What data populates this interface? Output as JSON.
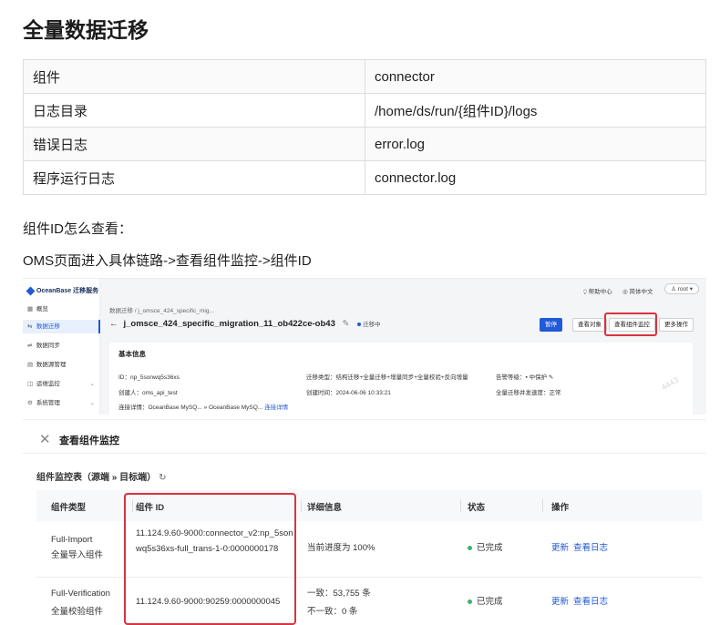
{
  "doc": {
    "title": "全量数据迁移",
    "table": [
      [
        "组件",
        "connector"
      ],
      [
        "日志目录",
        "/home/ds/run/{组件ID}/logs"
      ],
      [
        "错误日志",
        "error.log"
      ],
      [
        "程序运行日志",
        "connector.log"
      ]
    ],
    "para1": "组件ID怎么查看：",
    "para2": "OMS页面进入具体链路->查看组件监控->组件ID"
  },
  "oms": {
    "logo": "OceanBase 迁移服务",
    "nav": [
      {
        "icon": "▦",
        "label": "概览",
        "active": false,
        "chev": ""
      },
      {
        "icon": "⇆",
        "label": "数据迁移",
        "active": true,
        "chev": ""
      },
      {
        "icon": "⇌",
        "label": "数据同步",
        "active": false,
        "chev": ""
      },
      {
        "icon": "▤",
        "label": "数据源管理",
        "active": false,
        "chev": ""
      },
      {
        "icon": "◫",
        "label": "运维监控",
        "active": false,
        "chev": "⌄"
      },
      {
        "icon": "⚙",
        "label": "系统管理",
        "active": false,
        "chev": "⌄"
      }
    ],
    "top_help": "⍜ 帮助中心",
    "top_lang": "◎ 简体中文",
    "top_user": "♙ root ▾",
    "breadcrumb": "数据迁移 / j_omsce_424_specific_mig...",
    "back": "←",
    "title": "j_omsce_424_specific_migration_11_ob422ce-ob43",
    "edit": "✎",
    "status": "迁移中",
    "buttons": {
      "pause": "暂停",
      "view_objects": "查看对象",
      "view_monitor": "查看组件监控",
      "more": "更多操作"
    },
    "card_title": "基本信息",
    "fields": {
      "id": "ID：np_5sonwq5s36xs",
      "creator": "创建人：oms_api_test",
      "conn_label": "连接详情：OceanBase MySQ...",
      "conn_arrow": "»",
      "conn_target": "OceanBase MySQ...",
      "conn_link": "连接详情",
      "migration_type": "迁移类型：结构迁移+全量迁移+增量同步+全量校验+反向增量",
      "created_at": "创建时间：2024-06-06 10:33:21",
      "alert_level": "告警等级：▪ 中保护 ✎",
      "concurrency": "全量迁移并发速度：正常"
    }
  },
  "monitor": {
    "close": "✕",
    "title": "查看组件监控",
    "subtitle": "组件监控表（源端 » 目标端）",
    "refresh": "↻",
    "headers": [
      "组件类型",
      "组件 ID",
      "详细信息",
      "状态",
      "操作"
    ],
    "rows": [
      {
        "type_en": "Full-Import",
        "type_cn": "全量导入组件",
        "id": "11.124.9.60-9000:connector_v2:np_5sonwq5s36xs-full_trans-1-0:0000000178",
        "detail1": "当前进度为 100%",
        "detail2": "",
        "status": "已完成",
        "action1": "更新",
        "action2": "查看日志"
      },
      {
        "type_en": "Full-Verification",
        "type_cn": "全量校验组件",
        "id": "11.124.9.60-9000:90259:0000000045",
        "detail1": "一致：53,755 条",
        "detail2": "不一致：0 条",
        "status": "已完成",
        "action1": "更新",
        "action2": "查看日志"
      }
    ]
  },
  "watermark": "4443"
}
